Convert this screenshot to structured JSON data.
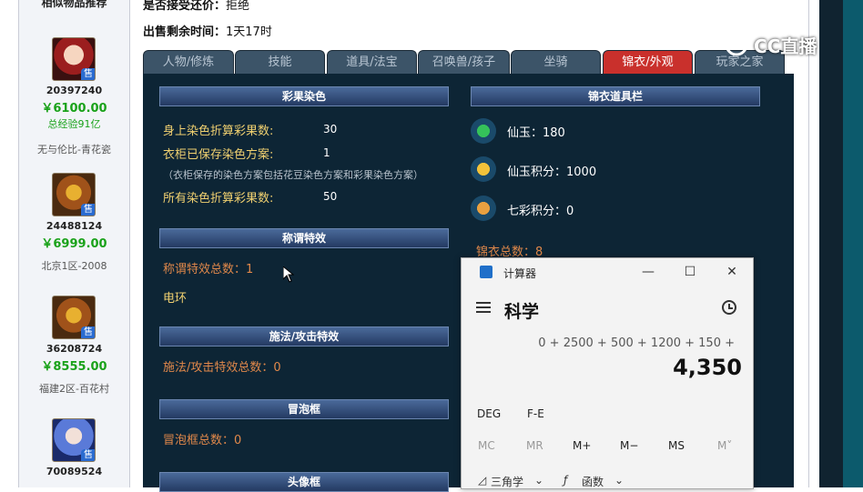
{
  "left": {
    "header": "相似物品推荐",
    "items": [
      {
        "id": "20397240",
        "price": "￥6100.00",
        "note": "总经验91亿",
        "note_green": true,
        "server": "无与伦比-青花瓷",
        "badge": "售"
      },
      {
        "id": "24488124",
        "price": "￥6999.00",
        "note": "北京1区-2008",
        "note_green": false,
        "badge": "售"
      },
      {
        "id": "36208724",
        "price": "￥8555.00",
        "note": "福建2区-百花村",
        "note_green": false,
        "badge": "售"
      },
      {
        "id": "70089524",
        "badge": "售"
      }
    ]
  },
  "info": {
    "accept_offer_label": "是否接受还价：",
    "accept_offer_value": "拒绝",
    "remaining_label": "出售剩余时间：",
    "remaining_value": "1天17时"
  },
  "tabs": [
    "人物/修炼",
    "技能",
    "道具/法宝",
    "召唤兽/孩子",
    "坐骑",
    "锦衣/外观",
    "玩家之家"
  ],
  "active_tab": "锦衣/外观",
  "sections": {
    "dye": {
      "title": "彩果染色",
      "body_dye_label": "身上染色折算彩果数:",
      "body_dye_value": "30",
      "wardrobe_label": "衣柜已保存染色方案:",
      "wardrobe_value": "1",
      "wardrobe_note": "（衣柜保存的染色方案包括花豆染色方案和彩果染色方案）",
      "all_dye_label": "所有染色折算彩果数:",
      "all_dye_value": "50"
    },
    "title_effect": {
      "title": "称谓特效",
      "count_label": "称谓特效总数：1",
      "item": "电环"
    },
    "cast_effect": {
      "title": "施法/攻击特效",
      "count_label": "施法/攻击特效总数：0"
    },
    "bubble": {
      "title": "冒泡框",
      "count_label": "冒泡框总数：0"
    },
    "avatar_frame": {
      "title": "头像框"
    },
    "jinyi_bar": {
      "title": "锦衣道具栏",
      "xianyu_label": "仙玉：180",
      "xianyu_points_label": "仙玉积分：1000",
      "qicai_points_label": "七彩积分：0",
      "total_label": "锦衣总数：8"
    }
  },
  "calculator": {
    "app_title": "计算器",
    "mode": "科学",
    "expression": "0 + 2500 + 500 + 1200 + 150 +",
    "result": "4,350",
    "row1": [
      "DEG",
      "F-E"
    ],
    "row2": [
      "MC",
      "MR",
      "M+",
      "M−",
      "MS",
      "M˅"
    ],
    "trig_label": "三角学",
    "func_label": "函数",
    "minimize": "—",
    "maximize": "☐",
    "close": "✕",
    "menu_icon": "hamburger-menu-icon",
    "history_icon": "history-icon"
  },
  "watermark": "CC直播",
  "colors": {
    "panel_bg": "#0d2535",
    "label_yellow": "#f0d070",
    "label_orange": "#e0884a",
    "price_green": "#1aa21a",
    "active_tab_red": "#c9302c"
  }
}
